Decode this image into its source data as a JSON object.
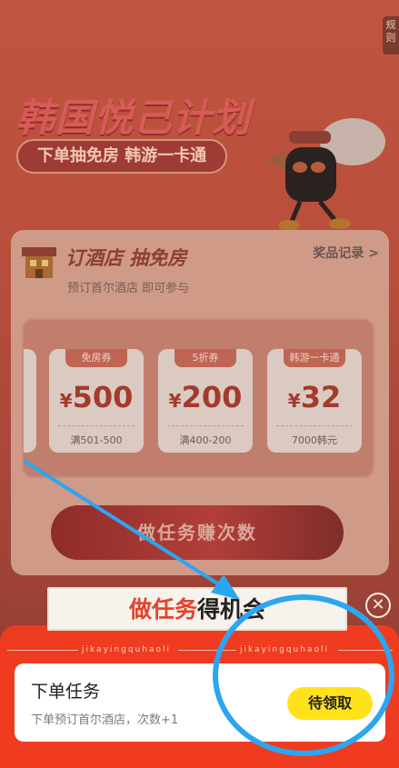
{
  "side_tab": "规则",
  "hero": {
    "title": "韩国悦己计划",
    "subtitle": "下单抽免房 韩游一卡通"
  },
  "card": {
    "title": "订酒店 抽免房",
    "subtitle": "预订首尔酒店 即可参与",
    "record_link": "奖品记录 >"
  },
  "coupons": [
    {
      "tag": "免房券",
      "currency": "¥",
      "amount": "500",
      "condition": "满501-500"
    },
    {
      "tag": "5折券",
      "currency": "¥",
      "amount": "200",
      "condition": "满400-200"
    },
    {
      "tag": "韩游一卡通",
      "currency": "¥",
      "amount": "32",
      "condition": "7000韩元"
    }
  ],
  "task_button": "做任务赚次数",
  "sheet": {
    "title_highlight": "做任务",
    "title_rest": "得机会",
    "pinyin": "jikayingquhaoli",
    "close_icon": "close-icon"
  },
  "task": {
    "name": "下单任务",
    "description": "下单预订首尔酒店，次数+1",
    "claim_label": "待领取"
  },
  "colors": {
    "sheet_red": "#ef3b20",
    "claim_yellow": "#ffe21b",
    "annotation_blue": "#2aa6f2"
  }
}
